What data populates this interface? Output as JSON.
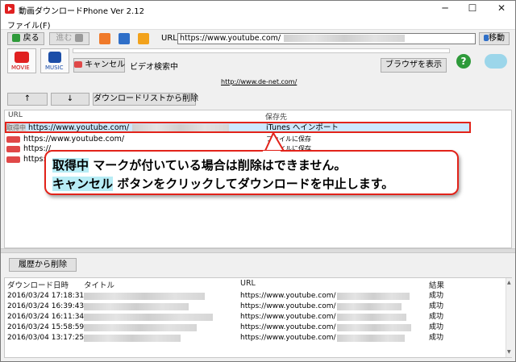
{
  "window": {
    "title": "動画ダウンロードPhone Ver 2.12",
    "minimize": "─",
    "maximize": "☐",
    "close": "✕"
  },
  "menu": {
    "file": "ファイル(F)"
  },
  "nav": {
    "back": "戻る",
    "forward": "進む",
    "url_label": "URL",
    "url_value": "https://www.youtube.com/",
    "move": "移動"
  },
  "toolbar": {
    "movie": "MOVIE",
    "music": "MUSIC",
    "cancel": "キャンセル",
    "status": "ビデオ検索中",
    "show_browser": "ブラウザを表示"
  },
  "site_link": "http://www.de-net.com/",
  "list_controls": {
    "up": "↑",
    "down": "↓",
    "delete_list": "ダウンロードリストから削除"
  },
  "list": {
    "headers": {
      "url": "URL",
      "save_to": "保存先"
    },
    "rows": [
      {
        "badge": "取得中",
        "url": "https://www.youtube.com/",
        "dest": "iTunes へインポート"
      },
      {
        "url": "https://www.youtube.com/",
        "dest": "ファイルに保存"
      },
      {
        "url": "https://",
        "dest": "ファイルに保存"
      },
      {
        "url": "https://",
        "dest": ""
      }
    ]
  },
  "callout": {
    "line1_hl": "取得中",
    "line1": "マークが付いている場合は削除はできません。",
    "line2_hl": "キャンセル",
    "line2": "ボタンをクリックしてダウンロードを中止します。"
  },
  "history": {
    "delete_button": "履歴から削除",
    "headers": {
      "date": "ダウンロード日時",
      "title": "タイトル",
      "url": "URL",
      "result": "結果"
    },
    "rows": [
      {
        "date": "2016/03/24 17:18:31",
        "url": "https://www.youtube.com/",
        "result": "成功"
      },
      {
        "date": "2016/03/24 16:39:43",
        "url": "https://www.youtube.com/",
        "result": "成功"
      },
      {
        "date": "2016/03/24 16:11:34",
        "url": "https://www.youtube.com/",
        "result": "成功"
      },
      {
        "date": "2016/03/24 15:58:59",
        "url": "https://www.youtube.com/",
        "result": "成功"
      },
      {
        "date": "2016/03/04 13:17:25",
        "url": "https://www.youtube.com/",
        "result": "成功"
      }
    ]
  },
  "colors": {
    "accent_red": "#e2231a",
    "highlight": "#b7ecf5",
    "selection": "#cce8ff"
  },
  "icons": [
    "app-icon",
    "back-arrow-icon",
    "forward-arrow-icon",
    "movie-icon",
    "music-icon",
    "help-icon",
    "qa-icon",
    "youtube-icon"
  ]
}
